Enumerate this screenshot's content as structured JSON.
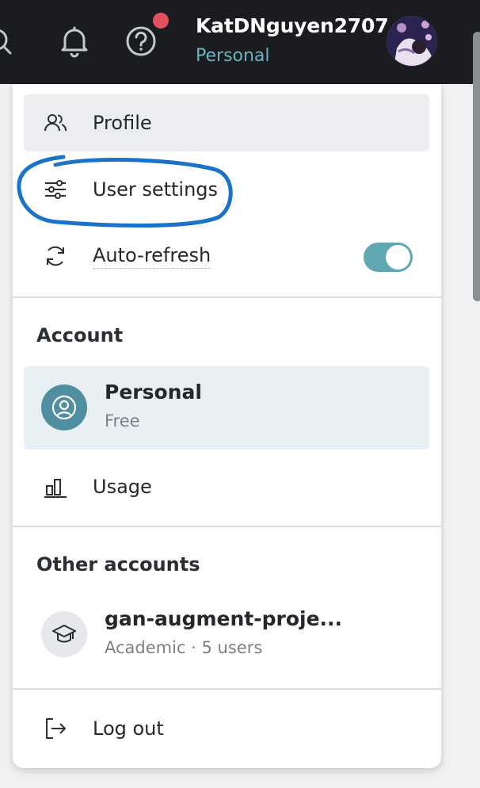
{
  "header": {
    "username": "KatDNguyen2707",
    "account_type": "Personal",
    "icons": [
      "search-icon",
      "bell-icon",
      "help-icon"
    ],
    "notification_color": "#e5505f"
  },
  "menu": {
    "profile_label": "Profile",
    "settings_label": "User settings",
    "autorefresh_label": "Auto-refresh",
    "autorefresh_on": true,
    "account_section": "Account",
    "personal": {
      "name": "Personal",
      "plan": "Free"
    },
    "usage_label": "Usage",
    "other_section": "Other accounts",
    "other_account": {
      "name": "gan-augment-proje...",
      "details": "Academic · 5 users"
    },
    "logout_label": "Log out"
  },
  "colors": {
    "accent": "#5fa7b3",
    "annotation": "#1a73c8",
    "topbar": "#1a1c20"
  }
}
